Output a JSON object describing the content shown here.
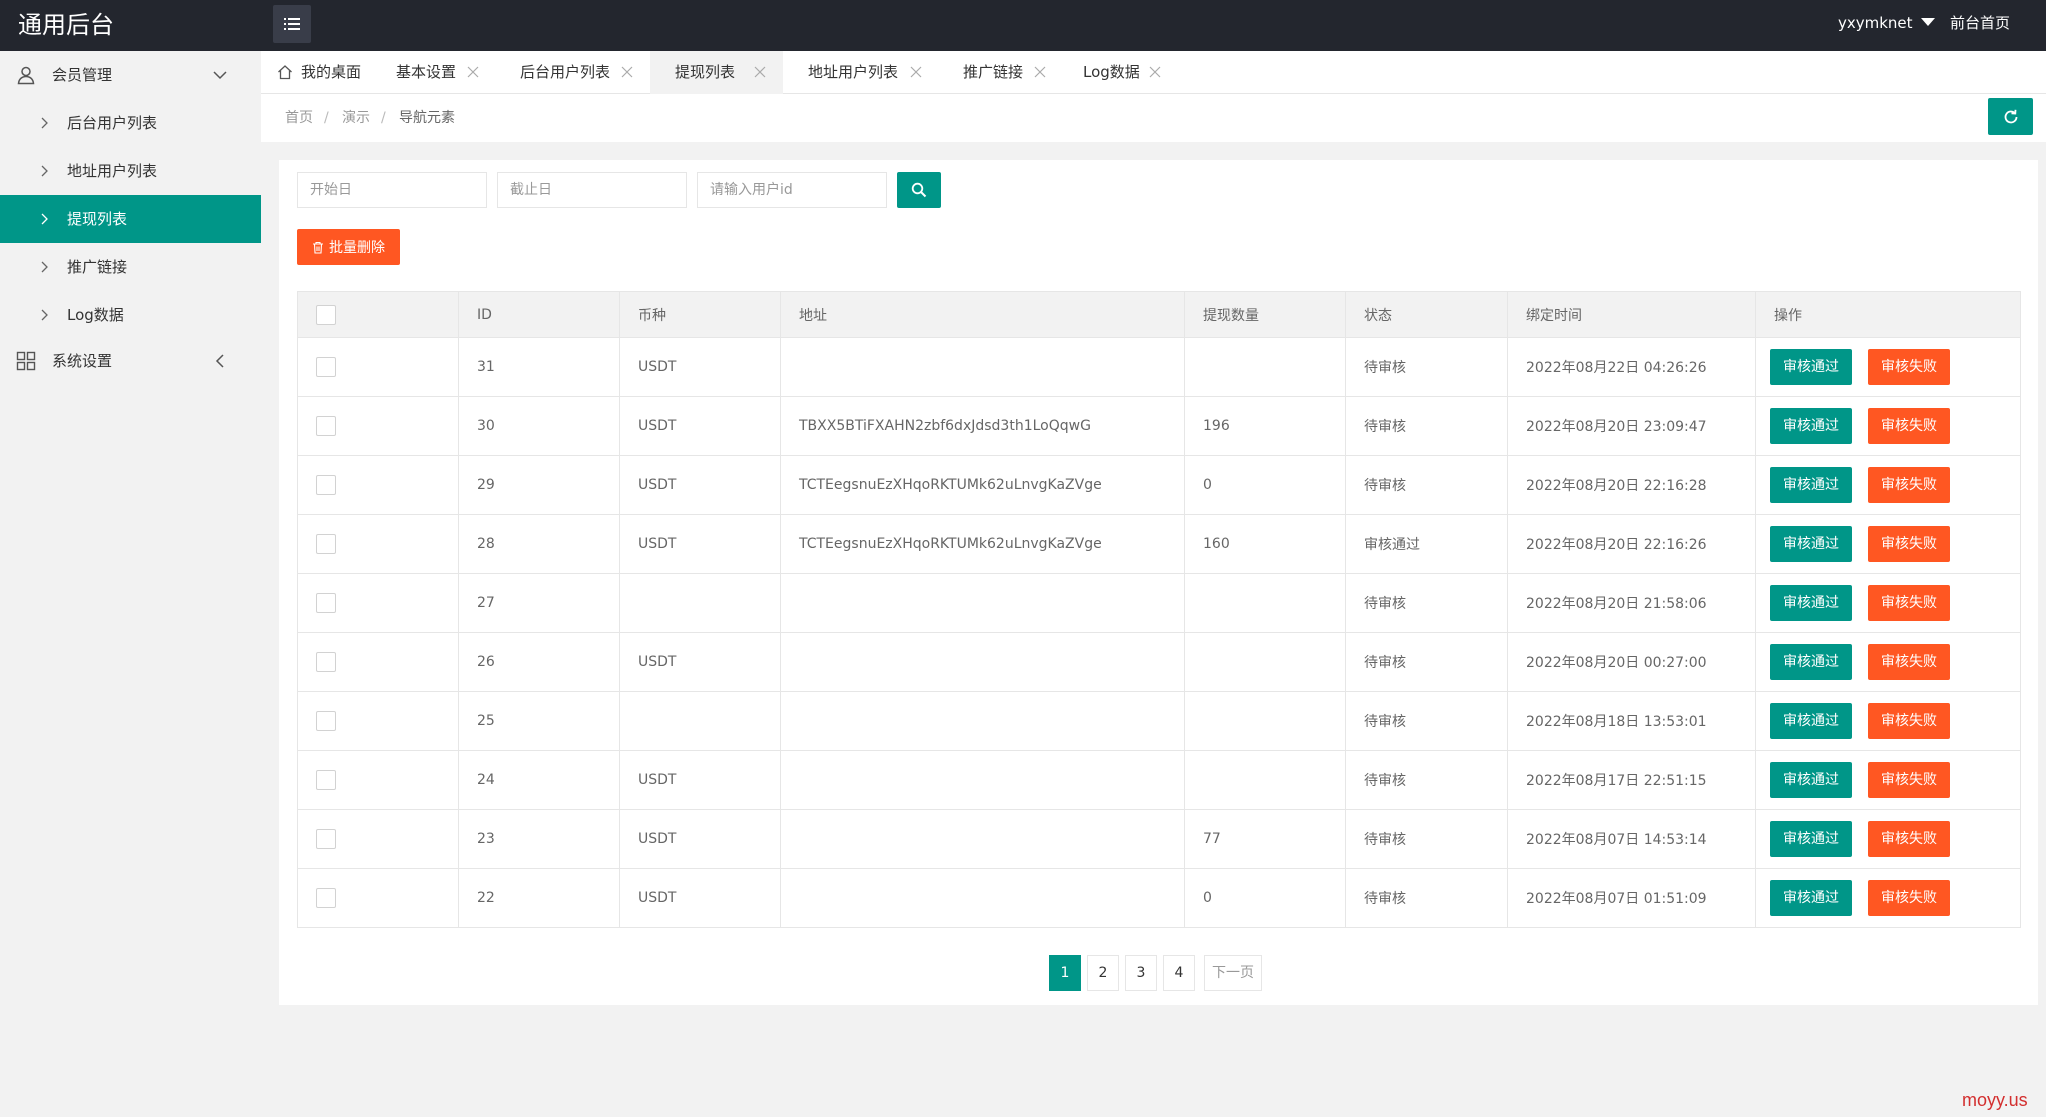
{
  "header": {
    "logo": "通用后台",
    "username": "yxymknet",
    "front_link": "前台首页"
  },
  "sidebar": {
    "groups": [
      {
        "label": "会员管理",
        "icon": "user-icon",
        "items": [
          {
            "label": "后台用户列表"
          },
          {
            "label": "地址用户列表"
          },
          {
            "label": "提现列表"
          },
          {
            "label": "推广链接"
          },
          {
            "label": "Log数据"
          }
        ]
      },
      {
        "label": "系统设置",
        "icon": "grid-icon"
      }
    ]
  },
  "tabs": [
    {
      "label": "我的桌面"
    },
    {
      "label": "基本设置"
    },
    {
      "label": "后台用户列表"
    },
    {
      "label": "提现列表"
    },
    {
      "label": "地址用户列表"
    },
    {
      "label": "推广链接"
    },
    {
      "label": "Log数据"
    }
  ],
  "breadcrumb": [
    "首页",
    "演示",
    "导航元素"
  ],
  "filters": {
    "start_placeholder": "开始日",
    "end_placeholder": "截止日",
    "userid_placeholder": "请输入用户id"
  },
  "batch_delete_label": "批量删除",
  "table": {
    "columns": [
      "ID",
      "币种",
      "地址",
      "提现数量",
      "状态",
      "绑定时间",
      "操作"
    ],
    "pass_label": "审核通过",
    "fail_label": "审核失败",
    "rows": [
      {
        "id": "31",
        "coin": "USDT",
        "address": "",
        "amount": "",
        "status": "待审核",
        "time": "2022年08月22日 04:26:26"
      },
      {
        "id": "30",
        "coin": "USDT",
        "address": "TBXX5BTiFXAHN2zbf6dxJdsd3th1LoQqwG",
        "amount": "196",
        "status": "待审核",
        "time": "2022年08月20日 23:09:47"
      },
      {
        "id": "29",
        "coin": "USDT",
        "address": "TCTEegsnuEzXHqoRKTUMk62uLnvgKaZVge",
        "amount": "0",
        "status": "待审核",
        "time": "2022年08月20日 22:16:28"
      },
      {
        "id": "28",
        "coin": "USDT",
        "address": "TCTEegsnuEzXHqoRKTUMk62uLnvgKaZVge",
        "amount": "160",
        "status": "审核通过",
        "time": "2022年08月20日 22:16:26"
      },
      {
        "id": "27",
        "coin": "",
        "address": "",
        "amount": "",
        "status": "待审核",
        "time": "2022年08月20日 21:58:06"
      },
      {
        "id": "26",
        "coin": "USDT",
        "address": "",
        "amount": "",
        "status": "待审核",
        "time": "2022年08月20日 00:27:00"
      },
      {
        "id": "25",
        "coin": "",
        "address": "",
        "amount": "",
        "status": "待审核",
        "time": "2022年08月18日 13:53:01"
      },
      {
        "id": "24",
        "coin": "USDT",
        "address": "",
        "amount": "",
        "status": "待审核",
        "time": "2022年08月17日 22:51:15"
      },
      {
        "id": "23",
        "coin": "USDT",
        "address": "",
        "amount": "77",
        "status": "待审核",
        "time": "2022年08月07日 14:53:14"
      },
      {
        "id": "22",
        "coin": "USDT",
        "address": "",
        "amount": "0",
        "status": "待审核",
        "time": "2022年08月07日 01:51:09"
      }
    ]
  },
  "pagination": {
    "pages": [
      "1",
      "2",
      "3",
      "4"
    ],
    "current": "1",
    "next_label": "下一页"
  },
  "watermark": "moyy.us",
  "colors": {
    "primary": "#009688",
    "danger": "#ff5722",
    "header_bg": "#23262e"
  }
}
